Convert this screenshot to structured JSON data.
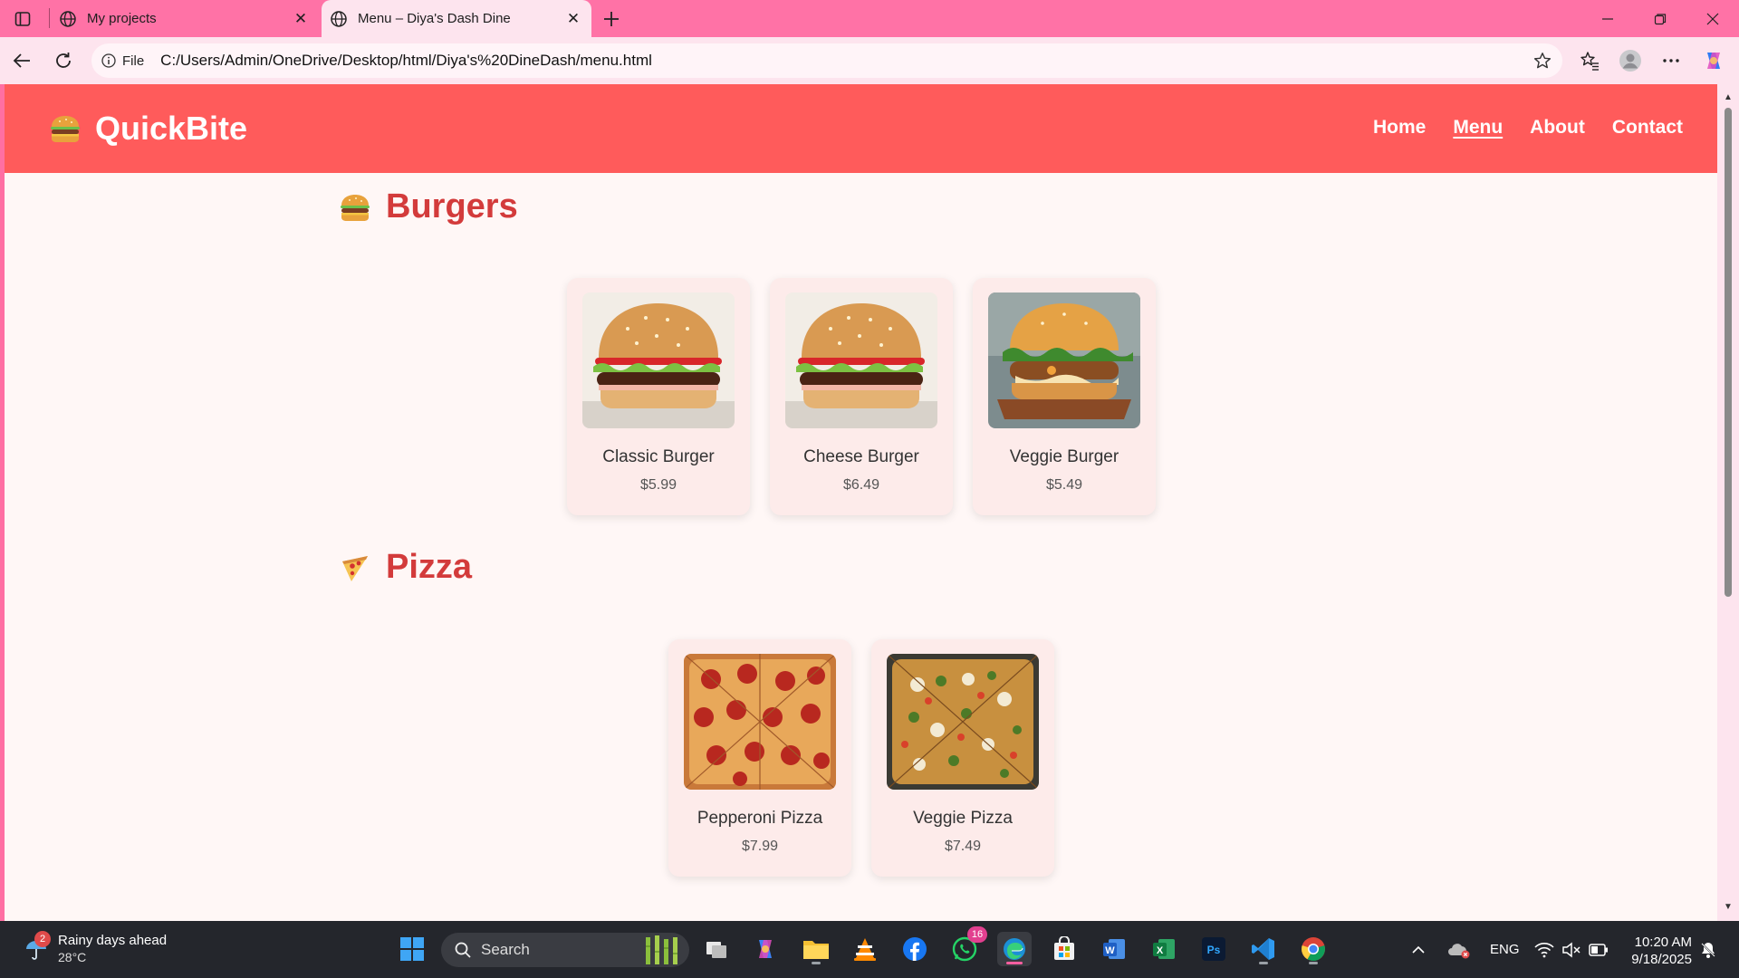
{
  "browser": {
    "tabs": [
      {
        "title": "My projects",
        "active": false
      },
      {
        "title": "Menu – Diya's Dash Dine",
        "active": true
      }
    ],
    "address": {
      "scheme_label": "File",
      "url": "C:/Users/Admin/OneDrive/Desktop/html/Diya's%20DineDash/menu.html"
    }
  },
  "site": {
    "brand": {
      "emoji": "🍔",
      "name": "QuickBite"
    },
    "nav": [
      {
        "label": "Home",
        "active": false
      },
      {
        "label": "Menu",
        "active": true
      },
      {
        "label": "About",
        "active": false
      },
      {
        "label": "Contact",
        "active": false
      }
    ],
    "sections": [
      {
        "emoji": "🍔",
        "title": "Burgers",
        "items": [
          {
            "name": "Classic Burger",
            "price": "$5.99"
          },
          {
            "name": "Cheese Burger",
            "price": "$6.49"
          },
          {
            "name": "Veggie Burger",
            "price": "$5.49"
          }
        ]
      },
      {
        "emoji": "🍕",
        "title": "Pizza",
        "items": [
          {
            "name": "Pepperoni Pizza",
            "price": "$7.99"
          },
          {
            "name": "Veggie Pizza",
            "price": "$7.49"
          }
        ]
      }
    ]
  },
  "taskbar": {
    "weather": {
      "title": "Rainy days ahead",
      "temp": "28°C",
      "badge": "2"
    },
    "search_label": "Search",
    "whatsapp_badge": "16",
    "language": "ENG",
    "time": "10:20 AM",
    "date": "9/18/2025"
  },
  "colors": {
    "chrome": "#ff72a6",
    "header": "#ff5b5b",
    "section_title": "#d33b3b",
    "page_bg": "#fff7f6",
    "card_bg": "#fdebea"
  }
}
